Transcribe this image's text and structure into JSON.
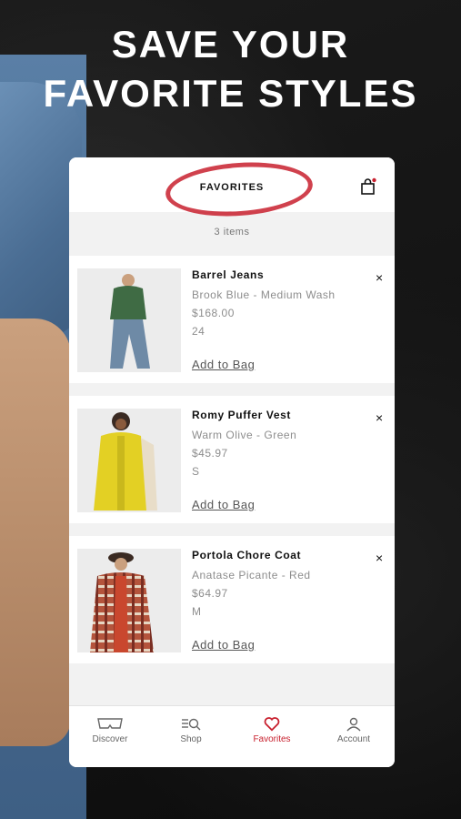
{
  "headline": {
    "line1": "SAVE YOUR",
    "line2": "FAVORITE STYLES"
  },
  "header": {
    "title": "FAVORITES",
    "bag_icon": "shopping-bag-icon",
    "accent": "#c8202e"
  },
  "list": {
    "count": "3 items",
    "items": [
      {
        "name": "Barrel Jeans",
        "color": "Brook Blue - Medium Wash",
        "price": "$168.00",
        "size": "24",
        "action": "Add to Bag",
        "remove": "×"
      },
      {
        "name": "Romy Puffer Vest",
        "color": "Warm Olive - Green",
        "price": "$45.97",
        "size": "S",
        "action": "Add to Bag",
        "remove": "×"
      },
      {
        "name": "Portola Chore Coat",
        "color": "Anatase Picante - Red",
        "price": "$64.97",
        "size": "M",
        "action": "Add to Bag",
        "remove": "×"
      }
    ]
  },
  "tabs": [
    {
      "label": "Discover",
      "icon": "discover-icon"
    },
    {
      "label": "Shop",
      "icon": "shop-search-icon"
    },
    {
      "label": "Favorites",
      "icon": "heart-icon",
      "active": true
    },
    {
      "label": "Account",
      "icon": "account-icon"
    }
  ]
}
